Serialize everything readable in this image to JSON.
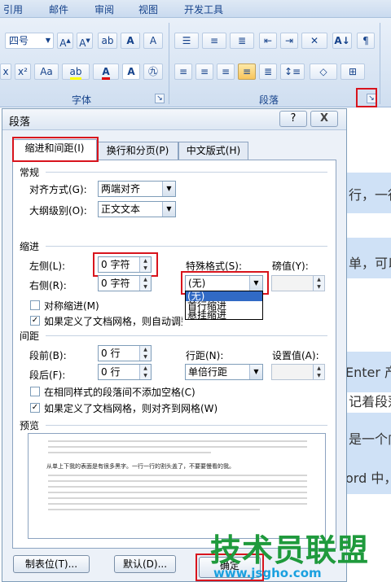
{
  "ribbon": {
    "tabs": [
      "引用",
      "邮件",
      "审阅",
      "视图",
      "开发工具"
    ],
    "font_size": "四号",
    "group_font": "字体",
    "group_paragraph": "段落"
  },
  "document": {
    "snippets": [
      "行，一行",
      "单，可以",
      "Enter 产",
      "记着段落",
      "是一个向",
      "ord 中，"
    ]
  },
  "dialog": {
    "title": "段落",
    "help": "?",
    "close": "X",
    "tabs": [
      "缩进和间距(I)",
      "换行和分页(P)",
      "中文版式(H)"
    ],
    "general": {
      "heading": "常规",
      "alignment_label": "对齐方式(G):",
      "alignment_value": "两端对齐",
      "outline_label": "大纲级别(O):",
      "outline_value": "正文文本"
    },
    "indent": {
      "heading": "缩进",
      "left_label": "左侧(L):",
      "left_value": "0 字符",
      "right_label": "右侧(R):",
      "right_value": "0 字符",
      "special_label": "特殊格式(S):",
      "special_value": "(无)",
      "special_options": [
        "(无)",
        "首行缩进",
        "悬挂缩进"
      ],
      "by_label": "磅值(Y):",
      "mirror_label": "对称缩进(M)",
      "mirror_checked": false,
      "auto_label": "如果定义了文档网格，则自动调整右缩进(D)",
      "auto_checked": true
    },
    "spacing": {
      "heading": "间距",
      "before_label": "段前(B):",
      "before_value": "0 行",
      "after_label": "段后(F):",
      "after_value": "0 行",
      "line_label": "行距(N):",
      "line_value": "单倍行距",
      "at_label": "设置值(A):",
      "no_space_label": "在相同样式的段落间不添加空格(C)",
      "no_space_checked": false,
      "snap_label": "如果定义了文档网格，则对齐到网格(W)",
      "snap_checked": true
    },
    "preview": {
      "heading": "预览",
      "sample": "从单上下我的表面是有很多黑字。一行一行的割头盖了，不要要慢看的我。"
    },
    "buttons": {
      "tabs": "制表位(T)...",
      "default": "默认(D)...",
      "ok": "确定"
    }
  },
  "watermark": {
    "name": "技术员联盟",
    "url": "www.jsgho.com"
  },
  "colors": {
    "highlight": "#d8141d",
    "watermark_green": "#1f9a3c",
    "watermark_blue": "#1aa0df"
  }
}
